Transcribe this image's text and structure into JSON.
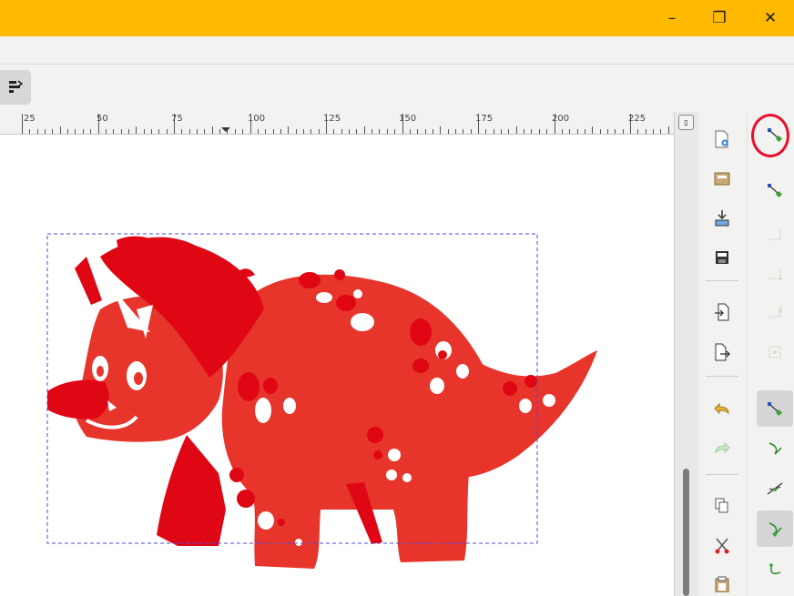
{
  "window": {
    "minimize_glyph": "–",
    "maximize_glyph": "❐",
    "close_glyph": "✕",
    "title_color": "#ffb900"
  },
  "ruler": {
    "labels": [
      "25",
      "50",
      "75",
      "100",
      "125",
      "150",
      "175",
      "200",
      "225"
    ]
  },
  "commands": {
    "icons": [
      "new-document-icon",
      "open-icon",
      "import-icon",
      "save-icon",
      "import-bitmap-icon",
      "export-icon",
      "undo-icon",
      "redo-icon",
      "copy-icon",
      "cut-icon",
      "paste-icon"
    ]
  },
  "snap": {
    "icons": [
      "snap-toggle-icon",
      "snap-nodes-icon",
      "snap-bbox-icon",
      "snap-corner-icon",
      "snap-edge-icon",
      "snap-midpoint-icon",
      "snap-paths-icon",
      "snap-path-node-icon",
      "snap-intersection-icon",
      "snap-cusp-icon",
      "snap-smooth-icon"
    ]
  },
  "colors": {
    "dino_main": "#e8352b",
    "dino_dark": "#e00714",
    "selection_box": "#4a4ae6",
    "highlight_circle": "#e8102a"
  }
}
